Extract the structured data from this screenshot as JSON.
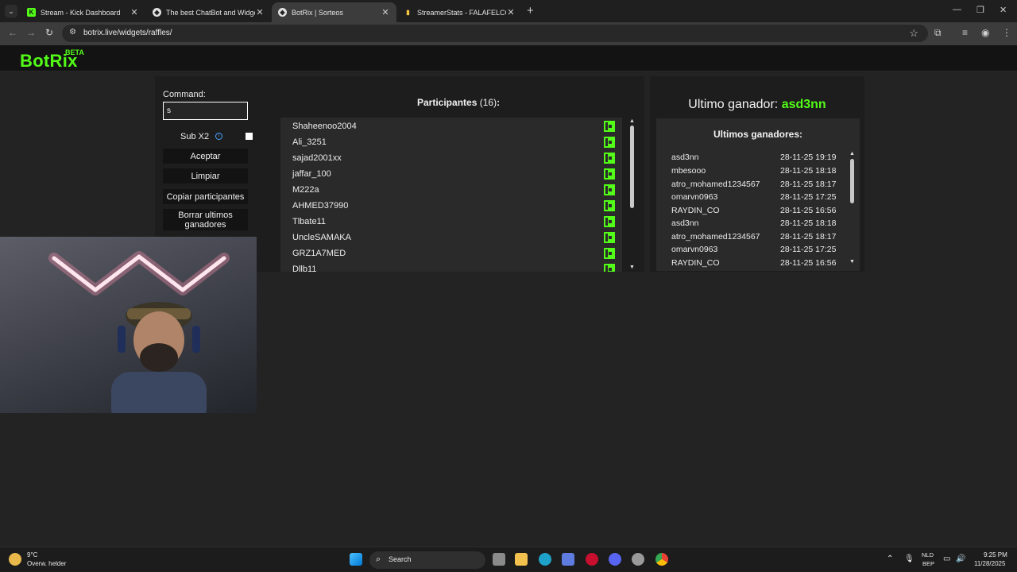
{
  "browser": {
    "tabs": [
      {
        "title": "Stream - Kick Dashboard",
        "favicon": "kick-icon",
        "active": false
      },
      {
        "title": "The best ChatBot and Widgets",
        "favicon": "botrix-icon",
        "active": false
      },
      {
        "title": "BotRix | Sorteos",
        "favicon": "botrix-icon",
        "active": true
      },
      {
        "title": "StreamerStats - FALAFELCO Pro",
        "favicon": "stats-icon",
        "active": false
      }
    ],
    "url": "botrix.live/widgets/raffles/"
  },
  "site": {
    "logo": "BotRix",
    "badge": "BETA",
    "brand_color": "#53fc18"
  },
  "raffle": {
    "command_label": "Command:",
    "command_value": "s",
    "sub_x2_label": "Sub X2",
    "buttons": {
      "accept": "Aceptar",
      "clear": "Limpiar",
      "copy": "Copiar participantes",
      "delete_winners": "Borrar ultimos ganadores"
    },
    "participants_label": "Participantes",
    "participants_count": "(16)",
    "participants_colon": ":",
    "participants": [
      "Shaheenoo2004",
      "Ali_3251",
      "sajad2001xx",
      "jaffar_100",
      "M222a",
      "AHMED37990",
      "Tlbate11",
      "UncleSAMAKA",
      "GRZ1A7MED",
      "Dllb11"
    ]
  },
  "winners": {
    "last_winner_label": "Ultimo ganador:",
    "last_winner": "asd3nn",
    "list_title": "Ultimos ganadores:",
    "list": [
      {
        "name": "asd3nn",
        "date": "28-11-25 19:19"
      },
      {
        "name": "mbesooo",
        "date": "28-11-25 18:18"
      },
      {
        "name": "atro_mohamed1234567",
        "date": "28-11-25 18:17"
      },
      {
        "name": "omarvn0963",
        "date": "28-11-25 17:25"
      },
      {
        "name": "RAYDIN_CO",
        "date": "28-11-25 16:56"
      },
      {
        "name": "asd3nn",
        "date": "28-11-25 18:18"
      },
      {
        "name": "atro_mohamed1234567",
        "date": "28-11-25 18:17"
      },
      {
        "name": "omarvn0963",
        "date": "28-11-25 17:25"
      },
      {
        "name": "RAYDIN_CO",
        "date": "28-11-25 16:56"
      }
    ]
  },
  "taskbar": {
    "weather_temp": "9°C",
    "weather_desc": "Overw. helder",
    "search_label": "Search",
    "lang_line1": "NLD",
    "lang_line2": "BEP",
    "time": "9:25 PM",
    "date": "11/28/2025"
  }
}
